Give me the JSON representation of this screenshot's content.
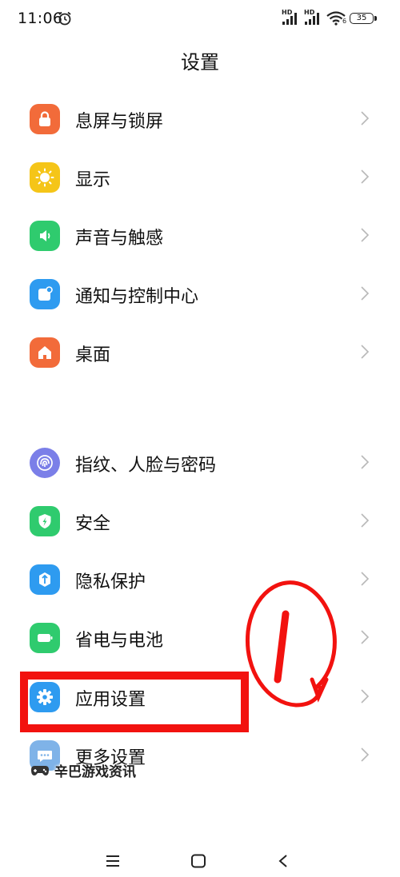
{
  "status_bar": {
    "time": "11:06",
    "hd1": "HD",
    "hd2": "HD",
    "wifi_sub": "6",
    "battery": "35"
  },
  "header": {
    "title": "设置"
  },
  "group1": [
    {
      "label": "息屏与锁屏",
      "icon": "lock-icon",
      "color": "#F26B3A"
    },
    {
      "label": "显示",
      "icon": "sun-icon",
      "color": "#F5C518"
    },
    {
      "label": "声音与触感",
      "icon": "speaker-icon",
      "color": "#2FCB6E"
    },
    {
      "label": "通知与控制中心",
      "icon": "notification-icon",
      "color": "#2E9BF0"
    },
    {
      "label": "桌面",
      "icon": "home-icon",
      "color": "#F26B3A"
    }
  ],
  "group2": [
    {
      "label": "指纹、人脸与密码",
      "icon": "fingerprint-icon",
      "color": "#7B7FE8"
    },
    {
      "label": "安全",
      "icon": "shield-icon",
      "color": "#2FCB6E"
    },
    {
      "label": "隐私保护",
      "icon": "privacy-icon",
      "color": "#2E9BF0"
    },
    {
      "label": "省电与电池",
      "icon": "battery-saver-icon",
      "color": "#2FCB6E"
    },
    {
      "label": "应用设置",
      "icon": "gear-icon",
      "color": "#2E9BF0"
    },
    {
      "label": "更多设置",
      "icon": "more-icon",
      "color": "#7FB3E8"
    }
  ],
  "annotation": {
    "color": "#F2120F",
    "mark": "highlight-box-app-settings"
  },
  "watermark": {
    "text": "辛巴游戏资讯"
  },
  "nav": {
    "menu": "menu-icon",
    "home": "home-square-icon",
    "back": "back-icon"
  }
}
